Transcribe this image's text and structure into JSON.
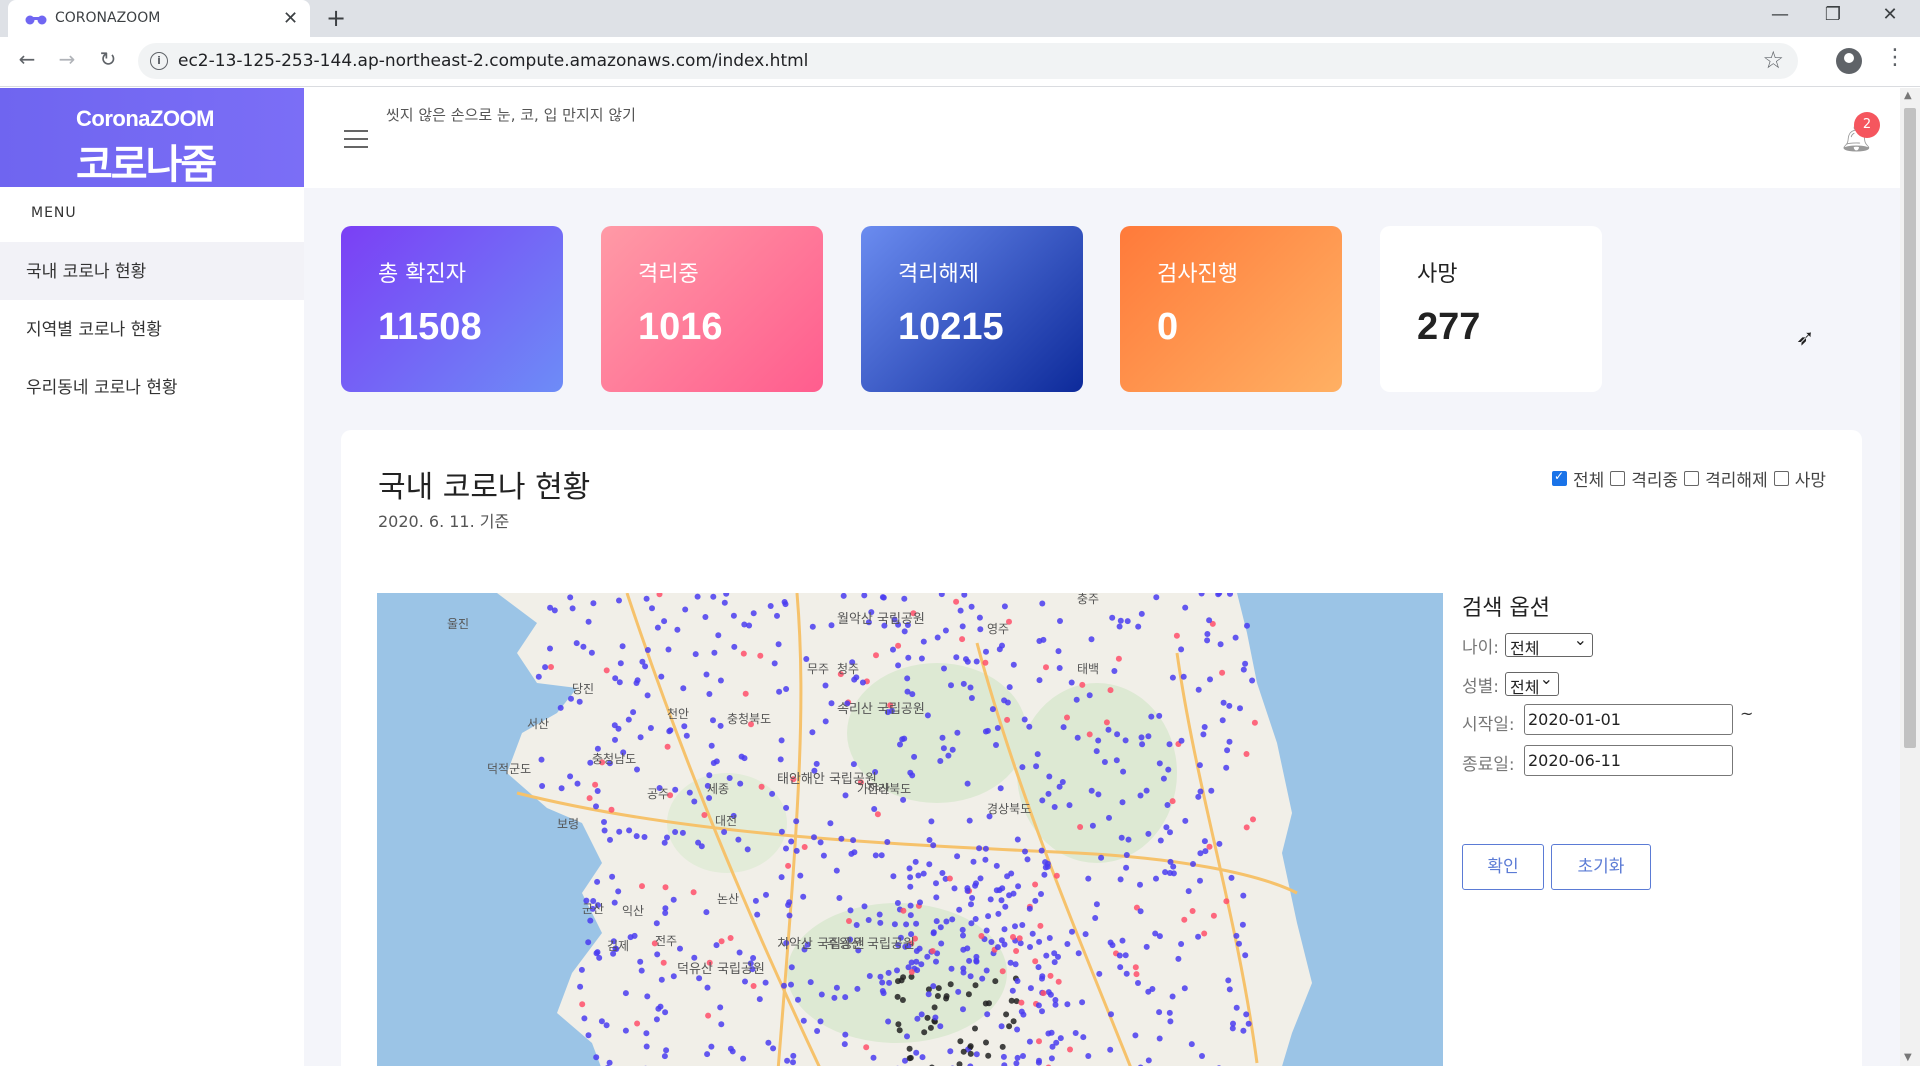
{
  "browser": {
    "tab_title": "CORONAZOOM",
    "tab_close": "✕",
    "new_tab": "+",
    "url": "ec2-13-125-253-144.ap-northeast-2.compute.amazonaws.com/index.html",
    "icons": [
      "back-arrow-icon",
      "forward-arrow-icon",
      "reload-icon",
      "info-icon",
      "star-icon",
      "profile-icon",
      "menu-dots-icon"
    ]
  },
  "sidebar": {
    "logo_top": "CoronaZOOM",
    "logo_bottom": "코로나줌",
    "menu_label": "MENU",
    "items": [
      {
        "label": "국내 코로나 현황",
        "active": true
      },
      {
        "label": "지역별 코로나 현황",
        "active": false
      },
      {
        "label": "우리동네 코로나 현황",
        "active": false
      }
    ]
  },
  "topbar": {
    "tip": "씻지 않은 손으로 눈, 코, 입 만지지 않기",
    "notification_count": "2"
  },
  "stats": [
    {
      "label": "총 확진자",
      "value": "11508"
    },
    {
      "label": "격리중",
      "value": "1016"
    },
    {
      "label": "격리해제",
      "value": "10215"
    },
    {
      "label": "검사진행",
      "value": "0"
    },
    {
      "label": "사망",
      "value": "277"
    }
  ],
  "panel": {
    "title": "국내 코로나 현황",
    "date": "2020. 6. 11. 기준",
    "filters": [
      {
        "label": "전체",
        "checked": true
      },
      {
        "label": "격리중",
        "checked": false
      },
      {
        "label": "격리해제",
        "checked": false
      },
      {
        "label": "사망",
        "checked": false
      }
    ],
    "map_labels": [
      "충청남도",
      "충청북도",
      "경상북도",
      "세종",
      "대전",
      "청주",
      "천안",
      "당진",
      "서산",
      "보령",
      "군산",
      "익산",
      "전주",
      "김제",
      "공주",
      "논산",
      "무주",
      "충주",
      "영주",
      "태백",
      "울진",
      "덕적군도",
      "태안해안 국립공원",
      "속리산 국립공원",
      "월악산 국립공원",
      "치악산 국립공원",
      "주왕산 국립공원",
      "덕유산 국립공원",
      "가야산",
      "전라북도"
    ],
    "search": {
      "title": "검색 옵션",
      "age_label": "나이:",
      "age_value": "전체",
      "gender_label": "성별:",
      "gender_value": "전체",
      "start_label": "시작일:",
      "start_value": "2020-01-01",
      "end_label": "종료일:",
      "end_value": "2020-06-11",
      "tilde": "~",
      "confirm": "확인",
      "reset": "초기화"
    }
  },
  "colors": {
    "brand": "#7066f2",
    "marker_confirmed": "#4a3cf0",
    "marker_isolated": "#ff4f6a",
    "marker_death": "#222222"
  }
}
